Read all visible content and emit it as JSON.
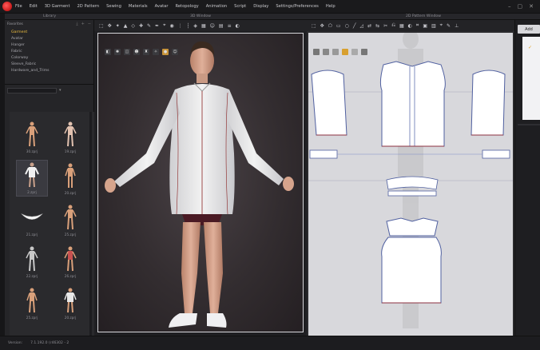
{
  "menu": {
    "items": [
      "File",
      "Edit",
      "3D Garment",
      "2D Pattern",
      "Sewing",
      "Materials",
      "Avatar",
      "Retopology",
      "Animation",
      "Script",
      "Display",
      "Settings/Preferences",
      "Help"
    ]
  },
  "panels": {
    "library_title": "Library",
    "window3d_title": "3D Window",
    "window2d_title": "2D Pattern Window"
  },
  "library": {
    "favorites_label": "Favorites",
    "favorites": [
      "Garment",
      "Avatar",
      "Hanger",
      "Fabric",
      "Colorway",
      "Sleeve_Fabric",
      "Hardware_and_Trims"
    ],
    "thumbnails": [
      {
        "label": "30.zprj"
      },
      {
        "label": "19.zprj"
      },
      {
        "label": "2.zprj"
      },
      {
        "label": "20.zprj"
      },
      {
        "label": "21.zprj"
      },
      {
        "label": "25.zprj"
      },
      {
        "label": "22.zprj"
      },
      {
        "label": "26.zprj"
      },
      {
        "label": "25.zprj"
      },
      {
        "label": "20.zprj"
      }
    ]
  },
  "right_panel": {
    "add_label": "Add"
  },
  "status": {
    "version_label": "Version:",
    "version_value": "7.1.192.0 (r46302 - 2"
  },
  "colors": {
    "accent": "#f0c040",
    "app_icon": "#d01010",
    "viewport_bg": "#332d30",
    "pattern_bg": "#d8d8dc"
  }
}
